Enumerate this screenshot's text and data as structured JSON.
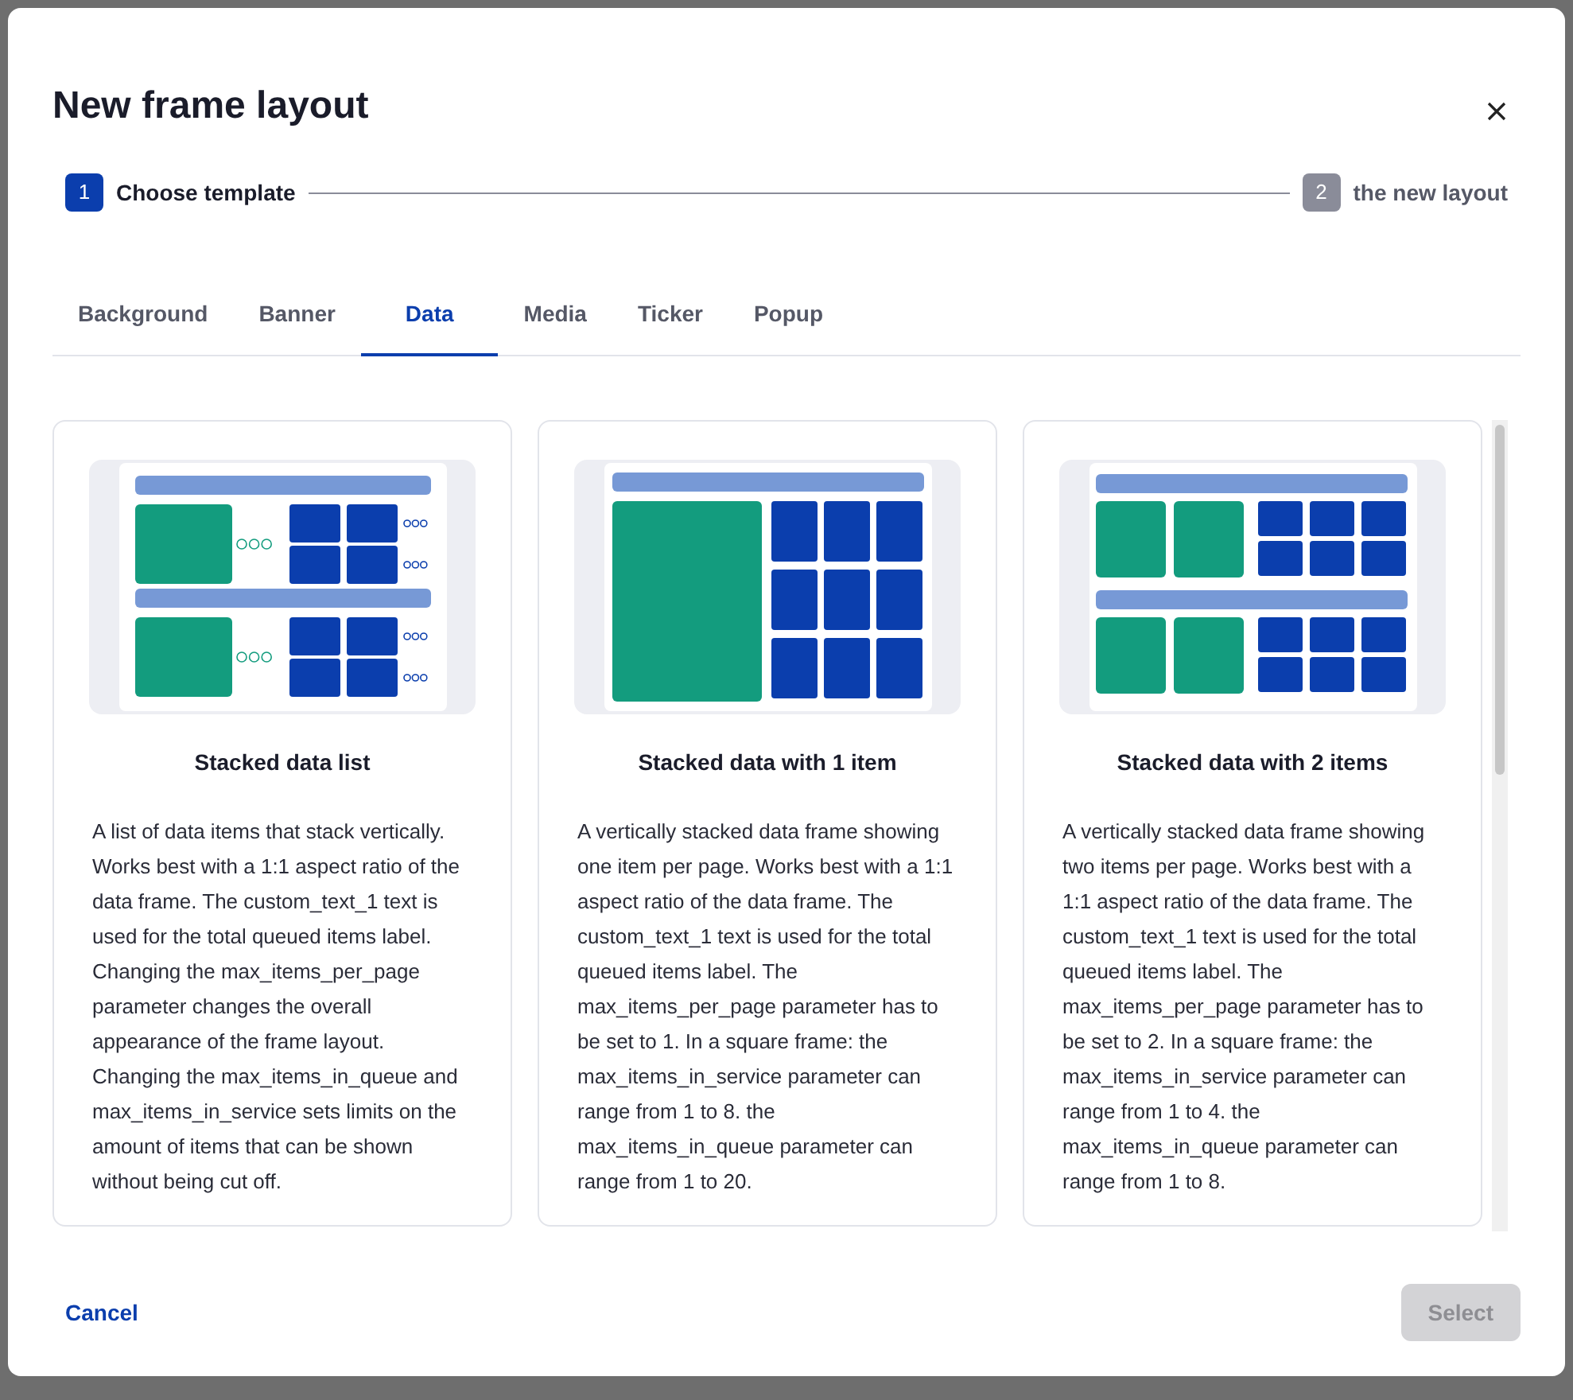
{
  "dialog": {
    "title": "New frame layout"
  },
  "steps": [
    {
      "number": "1",
      "label": "Choose template",
      "selected": true
    },
    {
      "number": "2",
      "label": "the new layout",
      "selected": false
    }
  ],
  "tabs": [
    {
      "label": "Background",
      "selected": false
    },
    {
      "label": "Banner",
      "selected": false
    },
    {
      "label": "Data",
      "selected": true
    },
    {
      "label": "Media",
      "selected": false
    },
    {
      "label": "Ticker",
      "selected": false
    },
    {
      "label": "Popup",
      "selected": false
    }
  ],
  "templates": [
    {
      "kind": "list",
      "title": "Stacked data list",
      "description": "A list of data items that stack vertically. Works best with a 1:1 aspect ratio of the data frame. The custom_text_1 text is used for the total queued items label. Changing the max_items_per_page parameter changes the overall appearance of the frame layout. Changing the max_items_in_queue and max_items_in_service sets limits on the amount of items that can be shown without being cut off."
    },
    {
      "kind": "one",
      "title": "Stacked data with 1 item",
      "description": "A vertically stacked data frame showing one item per page. Works best with a 1:1 aspect ratio of the data frame. The custom_text_1 text is used for the total queued items label. The max_items_per_page parameter has to be set to 1. In a square frame: the max_items_in_service parameter can range from 1 to 8. the max_items_in_queue parameter can range from 1 to 20."
    },
    {
      "kind": "two",
      "title": "Stacked data with 2 items",
      "description": "A vertically stacked data frame showing two items per page. Works best with a 1:1 aspect ratio of the data frame. The custom_text_1 text is used for the total queued items label. The max_items_per_page parameter has to be set to 2. In a square frame: the max_items_in_service parameter can range from 1 to 4. the max_items_in_queue parameter can range from 1 to 8."
    }
  ],
  "footer": {
    "cancel": "Cancel",
    "select": {
      "label": "Select",
      "disabled": true
    }
  }
}
